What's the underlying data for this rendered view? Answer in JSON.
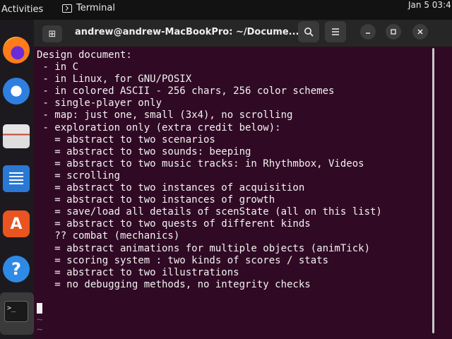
{
  "topbar": {
    "activities": "Activities",
    "app_name": "Terminal",
    "app_icon": "terminal-icon",
    "clock": "Jan 5  03:4"
  },
  "dock": {
    "items": [
      {
        "name": "Firefox",
        "icon": "firefox-icon"
      },
      {
        "name": "Thunderbird",
        "icon": "thunderbird-icon"
      },
      {
        "name": "Files",
        "icon": "files-icon"
      },
      {
        "name": "LibreOffice Writer",
        "icon": "writer-icon"
      },
      {
        "name": "Ubuntu Software",
        "icon": "app-store-icon",
        "glyph": "A"
      },
      {
        "name": "Help",
        "icon": "help-icon",
        "glyph": "?"
      },
      {
        "name": "Terminal",
        "icon": "terminal-icon",
        "glyph": ">_"
      }
    ]
  },
  "window": {
    "title": "andrew@andrew-MacBookPro: ~/Docume...",
    "new_tab_icon": "⊞",
    "search_icon": "search-icon",
    "menu_icon": "hamburger-icon",
    "minimize_icon": "minimize-icon",
    "maximize_icon": "maximize-icon",
    "close_icon": "close-icon"
  },
  "terminal": {
    "lines": [
      "Design document:",
      " - in C",
      " - in Linux, for GNU/POSIX",
      " - in colored ASCII - 256 chars, 256 color schemes",
      " - single-player only",
      " - map: just one, small (3x4), no scrolling",
      " - exploration only (extra credit below):",
      "   = abstract to two scenarios",
      "   = abstract to two sounds: beeping",
      "   = abstract to two music tracks: in Rhythmbox, Videos",
      "   = scrolling",
      "   = abstract to two instances of acquisition",
      "   = abstract to two instances of growth",
      "   = save/load all details of scenState (all on this list)",
      "   = abstract to two quests of different kinds",
      "   ?? combat (mechanics)",
      "   = abstract animations for multiple objects (animTick)",
      "   = scoring system : two kinds of scores / stats",
      "   = abstract to two illustrations",
      "   = no debugging methods, no integrity checks"
    ],
    "tilde": "~"
  },
  "colors": {
    "terminal_bg": "#300a24",
    "header_bg": "#262626",
    "text": "#f2f2f2",
    "tilde": "#4a6ea8",
    "accent": "#e95420"
  }
}
